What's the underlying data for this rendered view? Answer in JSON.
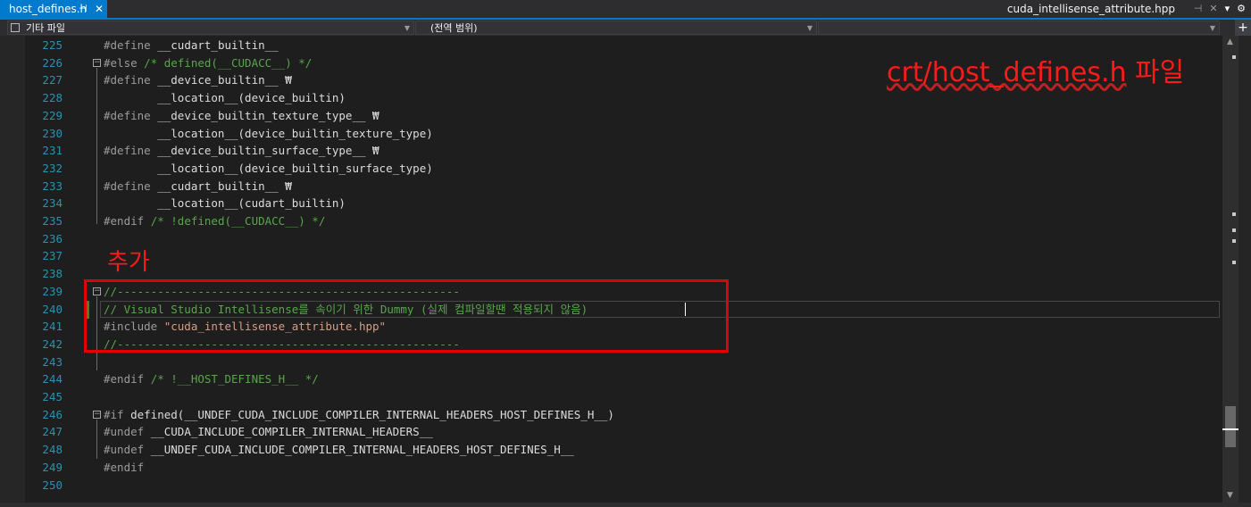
{
  "tabs": {
    "active": {
      "label": "host_defines.h",
      "pin": "⊣",
      "close": "✕"
    },
    "right_file": "cuda_intellisense_attribute.hpp",
    "right_icons": [
      "⊣",
      "✕",
      "▾",
      "⚙"
    ]
  },
  "navbar": {
    "project": "기타 파일",
    "scope": "(전역 범위)",
    "member": "",
    "split": "+"
  },
  "annotations": {
    "title": "crt/host_defines.h 파일",
    "title_underlined": "crt/host_defines.h",
    "title_suffix": " 파일",
    "added": "추가"
  },
  "lines": [
    {
      "n": "225",
      "parts": [
        [
          "pre",
          "#define "
        ],
        [
          "txt",
          "__cudart_builtin__"
        ]
      ]
    },
    {
      "n": "226",
      "parts": [
        [
          "pre",
          "#else "
        ],
        [
          "com",
          "/* defined(__CUDACC__) */"
        ]
      ]
    },
    {
      "n": "227",
      "parts": [
        [
          "pre",
          "#define "
        ],
        [
          "txt",
          "__device_builtin__ ₩"
        ]
      ]
    },
    {
      "n": "228",
      "parts": [
        [
          "txt",
          "        __location__(device_builtin)"
        ]
      ]
    },
    {
      "n": "229",
      "parts": [
        [
          "pre",
          "#define "
        ],
        [
          "txt",
          "__device_builtin_texture_type__ ₩"
        ]
      ]
    },
    {
      "n": "230",
      "parts": [
        [
          "txt",
          "        __location__(device_builtin_texture_type)"
        ]
      ]
    },
    {
      "n": "231",
      "parts": [
        [
          "pre",
          "#define "
        ],
        [
          "txt",
          "__device_builtin_surface_type__ ₩"
        ]
      ]
    },
    {
      "n": "232",
      "parts": [
        [
          "txt",
          "        __location__(device_builtin_surface_type)"
        ]
      ]
    },
    {
      "n": "233",
      "parts": [
        [
          "pre",
          "#define "
        ],
        [
          "txt",
          "__cudart_builtin__ ₩"
        ]
      ]
    },
    {
      "n": "234",
      "parts": [
        [
          "txt",
          "        __location__(cudart_builtin)"
        ]
      ]
    },
    {
      "n": "235",
      "parts": [
        [
          "pre",
          "#endif "
        ],
        [
          "com",
          "/* !defined(__CUDACC__) */"
        ]
      ]
    },
    {
      "n": "236",
      "parts": []
    },
    {
      "n": "237",
      "parts": []
    },
    {
      "n": "238",
      "parts": []
    },
    {
      "n": "239",
      "parts": [
        [
          "com",
          "//---------------------------------------------------"
        ]
      ]
    },
    {
      "n": "240",
      "parts": [
        [
          "com",
          "// Visual Studio Intellisense를 속이기 위한 Dummy (실제 컴파일할땐 적용되지 않음)"
        ]
      ]
    },
    {
      "n": "241",
      "parts": [
        [
          "pre",
          "#include "
        ],
        [
          "str",
          "\"cuda_intellisense_attribute.hpp\""
        ]
      ]
    },
    {
      "n": "242",
      "parts": [
        [
          "com",
          "//---------------------------------------------------"
        ]
      ]
    },
    {
      "n": "243",
      "parts": []
    },
    {
      "n": "244",
      "parts": [
        [
          "pre",
          "#endif "
        ],
        [
          "com",
          "/* !__HOST_DEFINES_H__ */"
        ]
      ]
    },
    {
      "n": "245",
      "parts": []
    },
    {
      "n": "246",
      "parts": [
        [
          "pre",
          "#if "
        ],
        [
          "txt",
          "defined(__UNDEF_CUDA_INCLUDE_COMPILER_INTERNAL_HEADERS_HOST_DEFINES_H__)"
        ]
      ]
    },
    {
      "n": "247",
      "parts": [
        [
          "pre",
          "#undef "
        ],
        [
          "txt",
          "__CUDA_INCLUDE_COMPILER_INTERNAL_HEADERS__"
        ]
      ]
    },
    {
      "n": "248",
      "parts": [
        [
          "pre",
          "#undef "
        ],
        [
          "txt",
          "__UNDEF_CUDA_INCLUDE_COMPILER_INTERNAL_HEADERS_HOST_DEFINES_H__"
        ]
      ]
    },
    {
      "n": "249",
      "parts": [
        [
          "pre",
          "#endif"
        ]
      ]
    },
    {
      "n": "250",
      "parts": []
    }
  ]
}
